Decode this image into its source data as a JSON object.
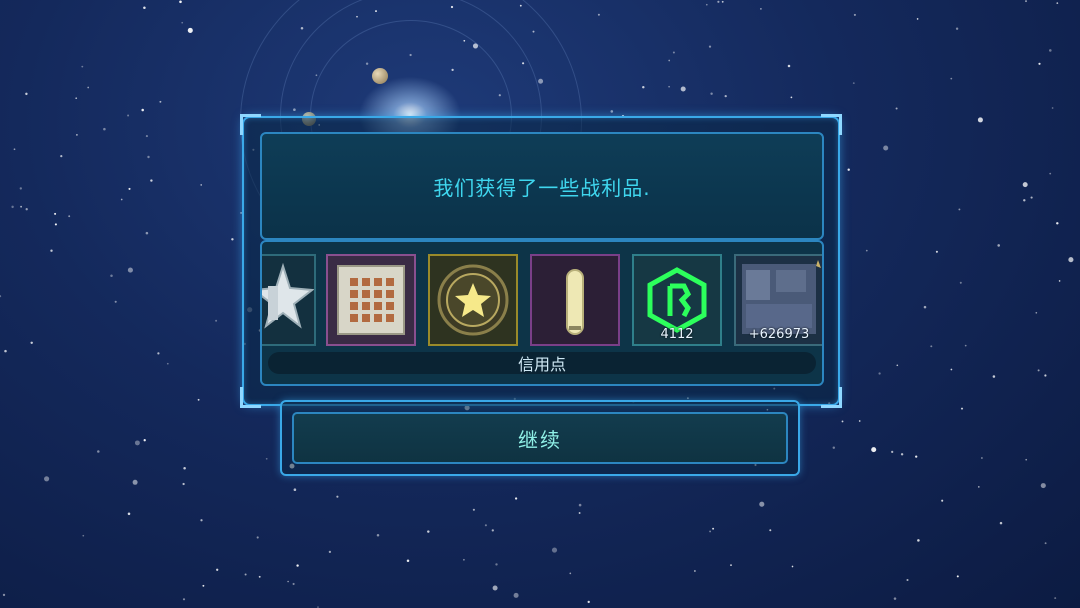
{
  "dialog": {
    "message": "我们获得了一些战利品.",
    "caption": "信用点",
    "continue_label": "继续"
  },
  "rewards": [
    {
      "name": "star-medal-icon",
      "count": ""
    },
    {
      "name": "circuit-chip-icon",
      "count": ""
    },
    {
      "name": "gold-star-badge-icon",
      "count": ""
    },
    {
      "name": "capsule-icon",
      "count": ""
    },
    {
      "name": "green-hexagon-credit-icon",
      "count": "4112"
    },
    {
      "name": "ship-blueprint-icon",
      "count": "+626973"
    }
  ],
  "colors": {
    "accent": "#3aa9e8",
    "message_text": "#3fd6ee",
    "button_text": "#8ff0e6"
  }
}
